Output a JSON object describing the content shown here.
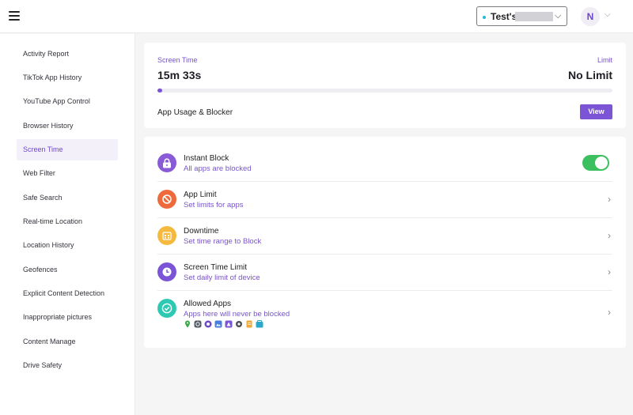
{
  "header": {
    "device_name": "Test's",
    "avatar_initial": "N"
  },
  "sidebar": {
    "items": [
      {
        "label": "Activity Report"
      },
      {
        "label": "TikTok App History"
      },
      {
        "label": "YouTube App Control"
      },
      {
        "label": "Browser History"
      },
      {
        "label": "Screen Time",
        "active": true
      },
      {
        "label": "Web Filter"
      },
      {
        "label": "Safe Search"
      },
      {
        "label": "Real-time Location"
      },
      {
        "label": "Location History"
      },
      {
        "label": "Geofences"
      },
      {
        "label": "Explicit Content Detection"
      },
      {
        "label": "Inappropriate pictures"
      },
      {
        "label": "Content Manage"
      },
      {
        "label": "Drive Safety"
      }
    ]
  },
  "screen_time": {
    "label": "Screen Time",
    "value": "15m 33s",
    "limit_label": "Limit",
    "limit_value": "No Limit",
    "progress_fraction": 0.01,
    "usage_label": "App Usage & Blocker",
    "view_button": "View"
  },
  "controls": [
    {
      "title": "Instant Block",
      "subtitle": "All apps are blocked",
      "icon": "lock-icon",
      "color": "#8a5bd6",
      "toggle_on": true
    },
    {
      "title": "App Limit",
      "subtitle": "Set limits for apps",
      "icon": "block-icon",
      "color": "#ee6a3c"
    },
    {
      "title": "Downtime",
      "subtitle": "Set time range to Block",
      "icon": "calendar-icon",
      "color": "#f5b93f"
    },
    {
      "title": "Screen Time Limit",
      "subtitle": "Set daily limit of device",
      "icon": "clock-icon",
      "color": "#7b55d6"
    },
    {
      "title": "Allowed Apps",
      "subtitle": "Apps here will never be blocked",
      "icon": "check-icon",
      "color": "#2ec9b3"
    }
  ],
  "allowed_app_icons": [
    "maps-icon",
    "settings-icon",
    "camera-icon",
    "photos-icon",
    "drive-icon",
    "gear-icon",
    "files-icon",
    "store-icon"
  ],
  "colors": {
    "accent": "#7b55d6",
    "toggle_on": "#3bbf5f"
  }
}
